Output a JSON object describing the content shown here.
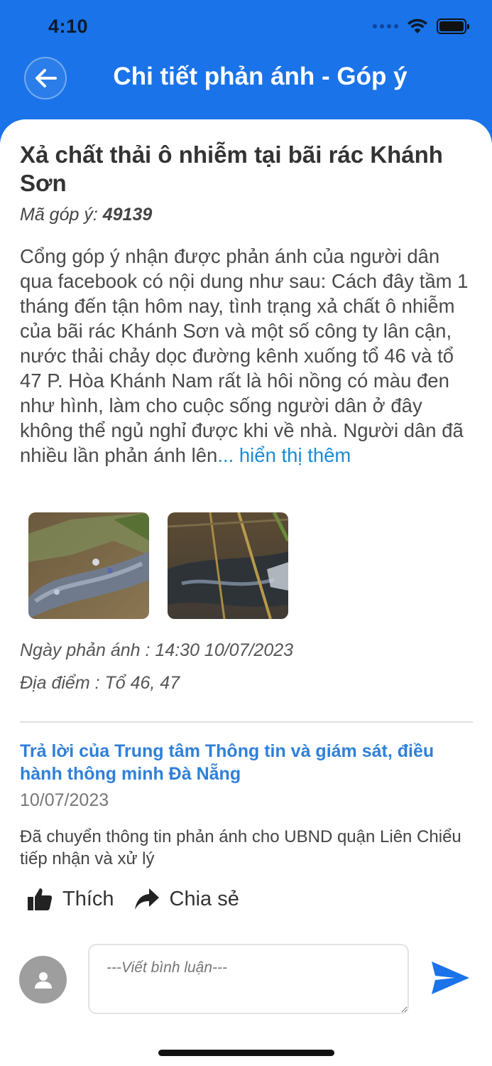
{
  "status_bar": {
    "time": "4:10"
  },
  "header": {
    "title": "Chi tiết phản ánh - Góp ý"
  },
  "report": {
    "title": "Xả chất thải ô nhiễm tại bãi rác Khánh Sơn",
    "code_label": "Mã góp ý:",
    "code_value": "49139",
    "body": "Cổng góp ý nhận được phản ánh của người dân qua facebook có nội dung như sau: Cách đây tầm 1 tháng đến tận hôm nay, tình trạng xả chất ô nhiễm của bãi rác Khánh Sơn và một số công ty lân cận, nước thải chảy dọc đường kênh xuống tổ 46 và tổ 47 P. Hòa Khánh Nam rất là hôi nồng có màu đen như hình, làm cho cuộc sống người dân ở đây không thể ngủ nghỉ được khi về nhà. Người dân đã nhiều lần phản ánh lên",
    "show_more": "... hiển thị thêm",
    "date_line": "Ngày phản ánh : 14:30 10/07/2023",
    "location_line": "Địa điểm : Tổ 46, 47"
  },
  "reply": {
    "title": "Trả lời của Trung tâm Thông tin và giám sát, điều hành thông minh Đà Nẵng",
    "date": "10/07/2023",
    "text": "Đã chuyển thông tin phản ánh cho UBND quận Liên Chiểu tiếp nhận và xử lý"
  },
  "actions": {
    "like_label": "Thích",
    "share_label": "Chia sẻ"
  },
  "comment": {
    "placeholder": "---Viết bình luận---"
  },
  "colors": {
    "primary": "#1a73e8",
    "link": "#2f80d8"
  }
}
